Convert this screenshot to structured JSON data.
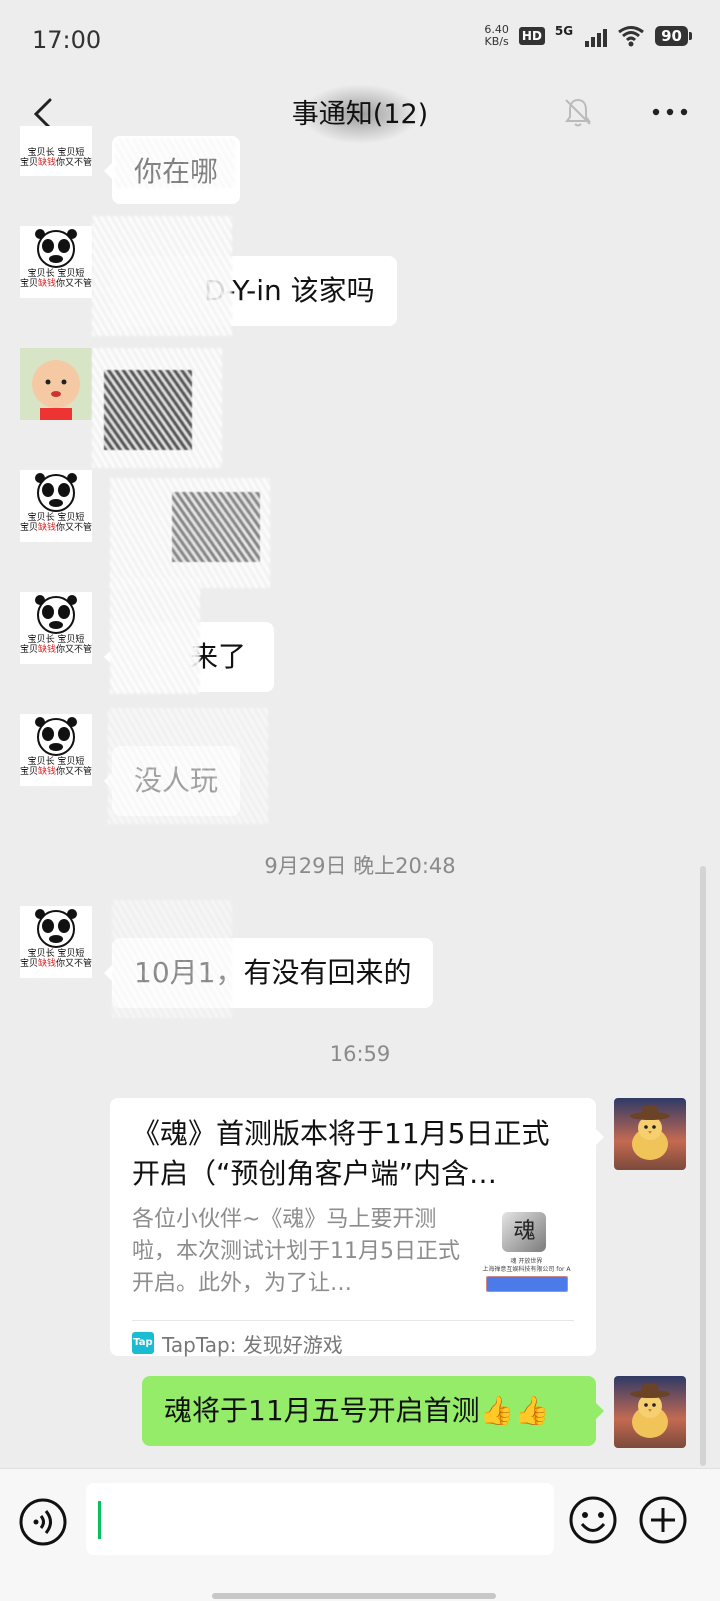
{
  "status_bar": {
    "time": "17:00",
    "net_speed_value": "6.40",
    "net_speed_unit": "KB/s",
    "hd": "HD",
    "network": "5G",
    "battery": "90"
  },
  "header": {
    "title": "事通知(12)",
    "icons": [
      "back-icon",
      "mute-icon",
      "more-icon"
    ]
  },
  "messages": [
    {
      "sender": "panda",
      "text": "你在哪"
    },
    {
      "sender": "panda",
      "text": "D-Y-in  该家吗"
    },
    {
      "sender": "baby",
      "text": ""
    },
    {
      "sender": "panda",
      "text": ""
    },
    {
      "sender": "panda",
      "text": "来了"
    },
    {
      "sender": "panda",
      "text": "没人玩"
    }
  ],
  "timestamp_1": "9月29日 晚上20:48",
  "message_oct": "10月1，有没有回来的",
  "timestamp_2": "16:59",
  "share_card": {
    "title": "《魂》首测版本将于11月5日正式开启（“预创角客户端”内含…",
    "description": "各位小伙伴~《魂》马上要开测啦，本次测试计划于11月5日正式开启。此外，为了让…",
    "thumb_logo": "魂",
    "thumb_line_1": "魂 开放世界",
    "thumb_line_2": "上海禅意互娱科技有限公司 for A",
    "source_icon": "Tap",
    "source": "TapTap: 发现好游戏"
  },
  "outgoing_message": "魂将于11月五号开启首测👍👍",
  "panda_caption": {
    "line1": "宝贝长  宝贝短",
    "line2_a": "宝贝",
    "line2_red": "缺钱",
    "line2_b": "你又不管"
  },
  "input": {
    "placeholder": ""
  },
  "colors": {
    "background": "#ededed",
    "outgoing_bubble": "#95ec69",
    "caret": "#07c160",
    "taptap": "#19bcd0"
  }
}
